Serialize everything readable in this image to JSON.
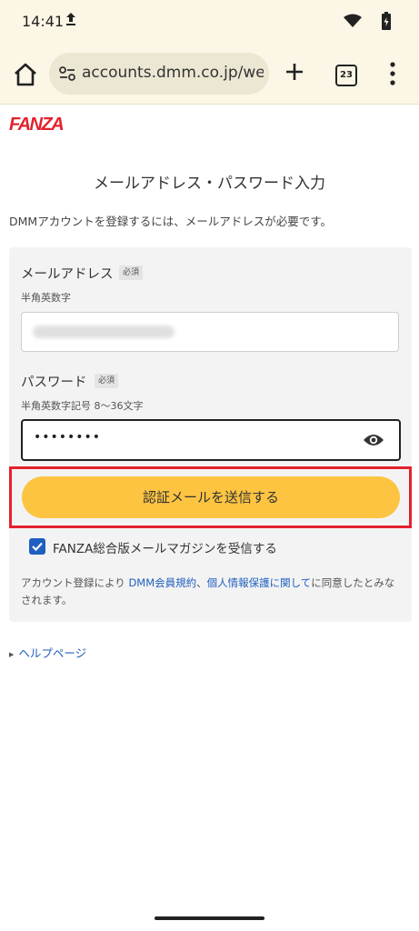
{
  "status_bar": {
    "time": "14:41"
  },
  "browser": {
    "url": "accounts.dmm.co.jp/wel",
    "tab_count": "23"
  },
  "page": {
    "logo_text": "FANZA",
    "title": "メールアドレス・パスワード入力",
    "intro": "DMMアカウントを登録するには、メールアドレスが必要です。",
    "email": {
      "label": "メールアドレス",
      "required_badge": "必須",
      "hint": "半角英数字"
    },
    "password": {
      "label": "パスワード",
      "required_badge": "必須",
      "hint": "半角英数字記号 8〜36文字",
      "value_masked": "••••••••"
    },
    "submit_label": "認証メールを送信する",
    "newsletter": {
      "checked": true,
      "label": "FANZA総合版メールマガジンを受信する"
    },
    "terms": {
      "prefix": "アカウント登録により ",
      "link1": "DMM会員規約",
      "sep": "、",
      "link2": "個人情報保護に関して",
      "suffix": "に同意したとみなされます。"
    },
    "help_link": "ヘルプページ"
  },
  "colors": {
    "accent_yellow": "#fcc441",
    "brand_red": "#e5212e",
    "link_blue": "#1f5fbf"
  }
}
